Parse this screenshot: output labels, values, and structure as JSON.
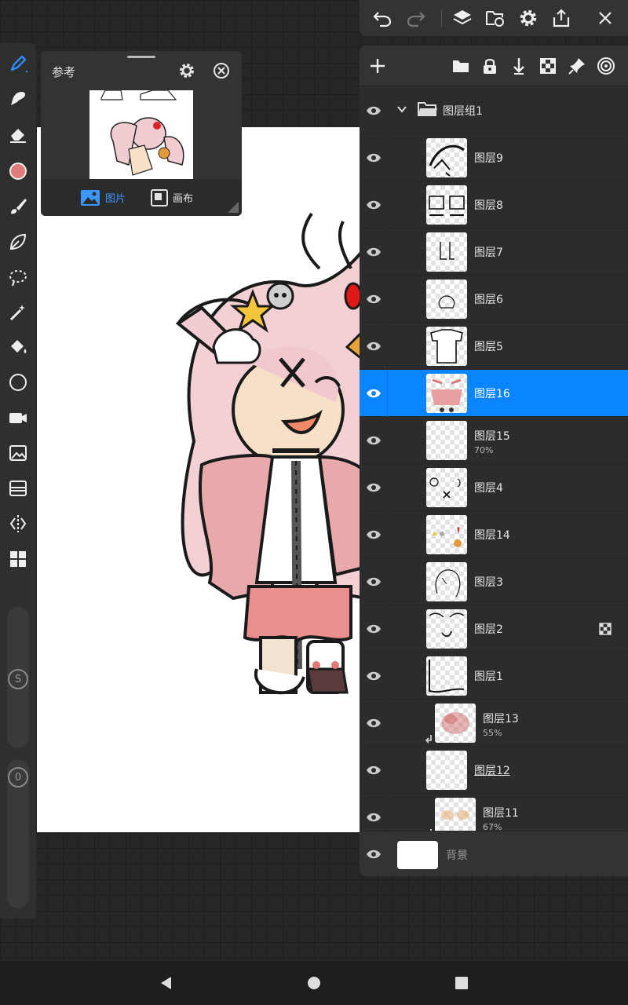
{
  "reference": {
    "title": "参考",
    "tabs": [
      {
        "label": "图片",
        "active": true
      },
      {
        "label": "画布",
        "active": false
      }
    ]
  },
  "layers_panel": {
    "group": {
      "name": "图层组1",
      "expanded": true
    },
    "layers": [
      {
        "name": "图层9",
        "opacity": ""
      },
      {
        "name": "图层8",
        "opacity": ""
      },
      {
        "name": "图层7",
        "opacity": ""
      },
      {
        "name": "图层6",
        "opacity": ""
      },
      {
        "name": "图层5",
        "opacity": ""
      },
      {
        "name": "图层16",
        "opacity": "",
        "selected": true
      },
      {
        "name": "图层15",
        "opacity": "70%"
      },
      {
        "name": "图层4",
        "opacity": ""
      },
      {
        "name": "图层14",
        "opacity": ""
      },
      {
        "name": "图层3",
        "opacity": ""
      },
      {
        "name": "图层2",
        "opacity": "",
        "alpha_lock": true
      },
      {
        "name": "图层1",
        "opacity": ""
      },
      {
        "name": "图层13",
        "opacity": "55%",
        "clipping": true
      },
      {
        "name": "图层12",
        "opacity": "",
        "underlined": true
      },
      {
        "name": "图层11",
        "opacity": "67%",
        "clipping": true
      }
    ],
    "background": {
      "name": "背景"
    }
  },
  "tools": [
    "pen-tool",
    "smudge-tool",
    "eraser-tool",
    "color-swatch",
    "brush-tool",
    "leaf-tool",
    "lasso-tool",
    "magic-wand-tool",
    "fill-tool",
    "shape-tool",
    "record-tool",
    "image-tool",
    "filter-tool",
    "symmetry-tool",
    "layout-tool"
  ],
  "brush_size_label": "S",
  "brush_opacity_label": "0",
  "colors": {
    "accent": "#0a84ff",
    "current_color": "#e07b7b",
    "panel": "#2c2c2c",
    "toolbar": "#2f2f2f"
  }
}
